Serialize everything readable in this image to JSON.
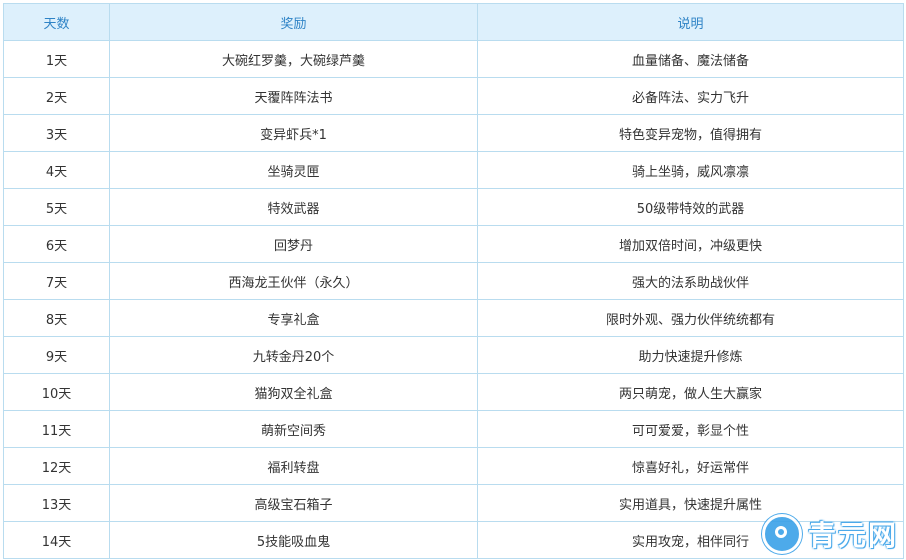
{
  "table": {
    "headers": {
      "day": "天数",
      "reward": "奖励",
      "description": "说明"
    },
    "rows": [
      {
        "day": "1天",
        "reward": "大碗红罗羹，大碗绿芦羹",
        "description": "血量储备、魔法储备"
      },
      {
        "day": "2天",
        "reward": "天覆阵阵法书",
        "description": "必备阵法、实力飞升"
      },
      {
        "day": "3天",
        "reward": "变异虾兵*1",
        "description": "特色变异宠物，值得拥有"
      },
      {
        "day": "4天",
        "reward": "坐骑灵匣",
        "description": "骑上坐骑，威风凛凛"
      },
      {
        "day": "5天",
        "reward": "特效武器",
        "description": "50级带特效的武器"
      },
      {
        "day": "6天",
        "reward": "回梦丹",
        "description": "增加双倍时间，冲级更快"
      },
      {
        "day": "7天",
        "reward": "西海龙王伙伴（永久）",
        "description": "强大的法系助战伙伴"
      },
      {
        "day": "8天",
        "reward": "专享礼盒",
        "description": "限时外观、强力伙伴统统都有"
      },
      {
        "day": "9天",
        "reward": "九转金丹20个",
        "description": "助力快速提升修炼"
      },
      {
        "day": "10天",
        "reward": "猫狗双全礼盒",
        "description": "两只萌宠，做人生大赢家"
      },
      {
        "day": "11天",
        "reward": "萌新空间秀",
        "description": "可可爱爱，彰显个性"
      },
      {
        "day": "12天",
        "reward": "福利转盘",
        "description": "惊喜好礼，好运常伴"
      },
      {
        "day": "13天",
        "reward": "高级宝石箱子",
        "description": "实用道具，快速提升属性"
      },
      {
        "day": "14天",
        "reward": "5技能吸血鬼",
        "description": "实用攻宠，相伴同行"
      }
    ]
  },
  "watermark": {
    "text": "青元网"
  },
  "colors": {
    "header_background": "#ddf0fc",
    "header_text": "#2e83c6",
    "border": "#b9dcef",
    "body_text": "#333333"
  }
}
